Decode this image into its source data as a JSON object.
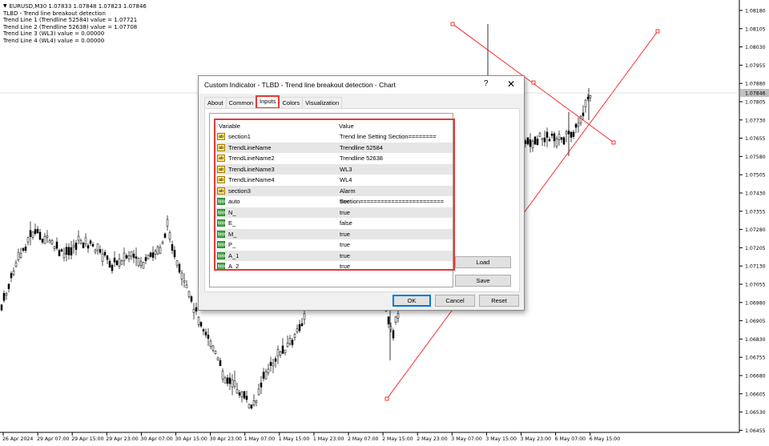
{
  "info": {
    "symbol_line": "EURUSD,M30  1.07833 1.07848 1.07823 1.07846",
    "lines": [
      "TLBD - Trend line breakout detection",
      "Trend Line 1 (Trendline 52584) value = 1.07721",
      "Trend Line 2 (Trendline 52638) value = 1.07708",
      "Trend Line 3 (WL3) value = 0.00000",
      "Trend Line 4 (WL4) value = 0.00000"
    ]
  },
  "price_axis": {
    "labels": [
      "1.08180",
      "1.08105",
      "1.08030",
      "1.07955",
      "1.07880",
      "1.07805",
      "1.07730",
      "1.07655",
      "1.07580",
      "1.07505",
      "1.07430",
      "1.07355",
      "1.07280",
      "1.07205",
      "1.07130",
      "1.07055",
      "1.06980",
      "1.06905",
      "1.06830",
      "1.06755",
      "1.06680",
      "1.06605",
      "1.06530",
      "1.06455"
    ],
    "current": "1.07846",
    "current_bg": "#c0c0c0"
  },
  "time_axis": {
    "labels": [
      "26 Apr 2024",
      "29 Apr 07:00",
      "29 Apr 15:00",
      "29 Apr 23:00",
      "30 Apr 07:00",
      "30 Apr 15:00",
      "30 Apr 23:00",
      "1 May 07:00",
      "1 May 15:00",
      "1 May 23:00",
      "2 May 07:00",
      "2 May 15:00",
      "2 May 23:00",
      "3 May 07:00",
      "3 May 15:00",
      "3 May 23:00",
      "6 May 07:00",
      "6 May 15:00"
    ]
  },
  "colors": {
    "trendline": "#ff0000",
    "candle": "#000000",
    "highlight": "#e53935"
  },
  "dialog": {
    "title": "Custom Indicator - TLBD - Trend line breakout detection - Chart",
    "help": "?",
    "close": "✕",
    "tabs": [
      "About",
      "Common",
      "Inputs",
      "Colors",
      "Visualization"
    ],
    "active_tab": "Inputs",
    "columns": [
      "Variable",
      "Value"
    ],
    "params": [
      {
        "icon": "ab",
        "name": "section1",
        "value": "Trend line  Setting Section========"
      },
      {
        "icon": "ab",
        "name": "TrendLineName",
        "value": "Trendline 52584"
      },
      {
        "icon": "ab",
        "name": "TrendLineName2",
        "value": "Trendline 52638"
      },
      {
        "icon": "ab",
        "name": "TrendLineName3",
        "value": "WL3"
      },
      {
        "icon": "ab",
        "name": "TrendLineName4",
        "value": "WL4"
      },
      {
        "icon": "ab",
        "name": "section3",
        "value": "Alarm Section========================"
      },
      {
        "icon": "bool",
        "name": "auto",
        "value": "true"
      },
      {
        "icon": "bool",
        "name": "N_",
        "value": "true"
      },
      {
        "icon": "bool",
        "name": "E_",
        "value": "false"
      },
      {
        "icon": "bool",
        "name": "M_",
        "value": "true"
      },
      {
        "icon": "bool",
        "name": "P_",
        "value": "true"
      },
      {
        "icon": "bool",
        "name": "A_1",
        "value": "true"
      },
      {
        "icon": "bool",
        "name": "A_2",
        "value": "true"
      }
    ],
    "buttons": {
      "load": "Load",
      "save": "Save",
      "ok": "OK",
      "cancel": "Cancel",
      "reset": "Reset"
    }
  }
}
